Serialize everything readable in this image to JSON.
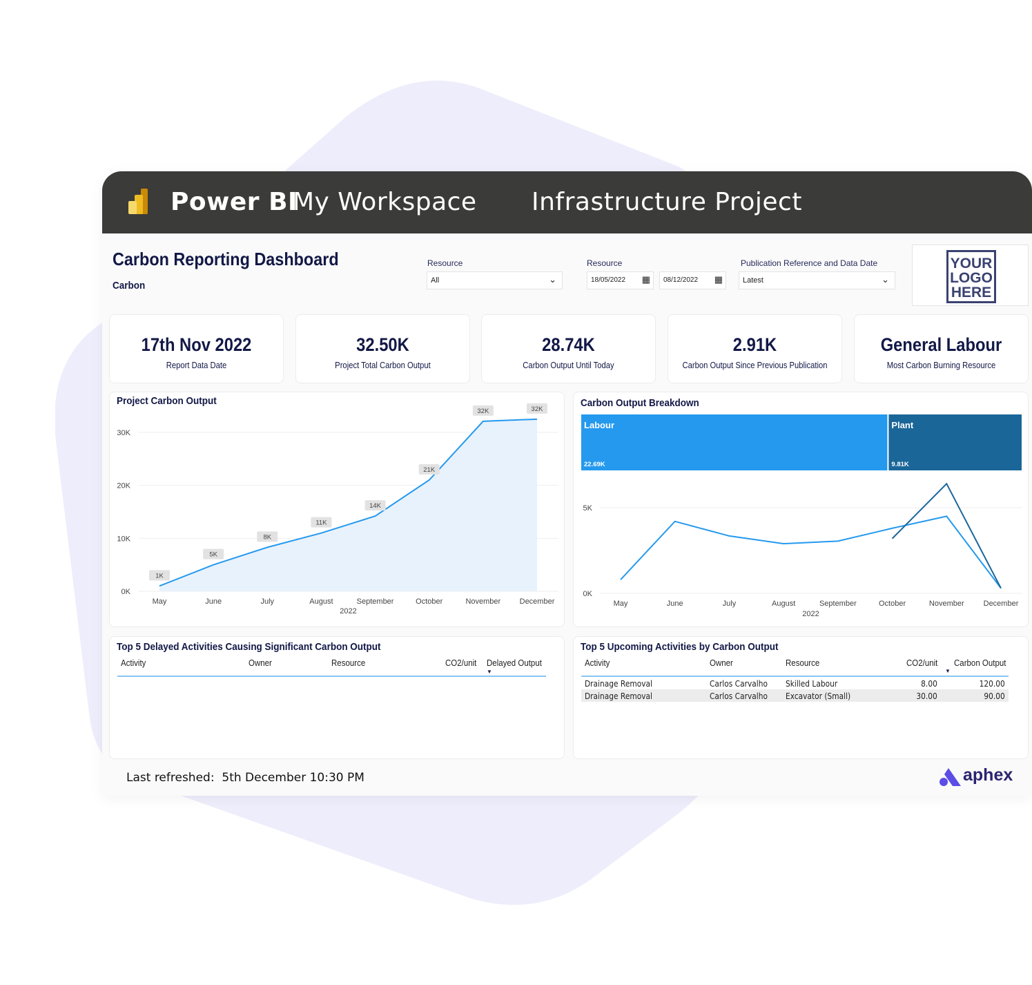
{
  "colors": {
    "accent": "#2499ee",
    "plant": "#1a6699",
    "header_bg": "#3b3b39",
    "title": "#121846",
    "background_shape": "#eeedfb"
  },
  "topbar": {
    "logo_icon": "power-bi-logo",
    "app": "Power BI",
    "workspace": "My Workspace",
    "project": "Infrastructure Project"
  },
  "header": {
    "title": "Carbon Reporting Dashboard",
    "subtitle": "Carbon",
    "logo_text": [
      "YOUR",
      "LOGO",
      "HERE"
    ]
  },
  "filters": {
    "resource": {
      "label": "Resource",
      "value": "All"
    },
    "date_range": {
      "label": "Resource",
      "start": "18/05/2022",
      "end": "08/12/2022"
    },
    "publication": {
      "label": "Publication Reference and Data Date",
      "value": "Latest"
    }
  },
  "cards": [
    {
      "value": "17th Nov 2022",
      "label": "Report Data Date"
    },
    {
      "value": "32.50K",
      "label": "Project Total Carbon Output"
    },
    {
      "value": "28.74K",
      "label": "Carbon Output Until Today"
    },
    {
      "value": "2.91K",
      "label": "Carbon Output Since Previous Publication"
    },
    {
      "value": "General Labour",
      "label": "Most Carbon Burning Resource"
    }
  ],
  "chart_data": [
    {
      "type": "area",
      "title": "Project Carbon Output",
      "categories": [
        "May",
        "June",
        "July",
        "August",
        "September",
        "October",
        "November",
        "December"
      ],
      "xlabel": "2022",
      "values": [
        1000,
        5000,
        8300,
        11000,
        14200,
        21000,
        32100,
        32500
      ],
      "data_labels": [
        "1K",
        "5K",
        "8K",
        "11K",
        "14K",
        "21K",
        "32K",
        "32K"
      ],
      "ylim": [
        0,
        30000
      ],
      "yticks": [
        "0K",
        "10K",
        "20K",
        "30K"
      ],
      "grid": true
    },
    {
      "type": "treemap",
      "title": "Carbon Output Breakdown",
      "series": [
        {
          "name": "Labour",
          "value": 22690,
          "label": "22.69K"
        },
        {
          "name": "Plant",
          "value": 9810,
          "label": "9.81K"
        }
      ]
    },
    {
      "type": "line",
      "categories": [
        "May",
        "June",
        "July",
        "August",
        "September",
        "October",
        "November",
        "December"
      ],
      "xlabel": "2022",
      "yticks": [
        "0K",
        "5K"
      ],
      "ylim": [
        0,
        6500
      ],
      "grid": true,
      "series": [
        {
          "name": "Labour",
          "values": [
            800,
            4200,
            3350,
            2900,
            3050,
            3800,
            4500,
            300
          ]
        },
        {
          "name": "Plant",
          "values": [
            null,
            null,
            null,
            null,
            null,
            3200,
            6400,
            300
          ]
        }
      ]
    }
  ],
  "delayed": {
    "title": "Top 5 Delayed Activities Causing Significant Carbon Output",
    "columns": [
      "Activity",
      "Owner",
      "Resource",
      "CO2/unit",
      "Delayed Output"
    ],
    "rows": []
  },
  "upcoming": {
    "title": "Top 5 Upcoming Activities by Carbon Output",
    "columns": [
      "Activity",
      "Owner",
      "Resource",
      "CO2/unit",
      "Carbon Output"
    ],
    "rows": [
      [
        "Drainage Removal",
        "Carlos Carvalho",
        "Skilled Labour",
        "8.00",
        "120.00"
      ],
      [
        "Drainage Removal",
        "Carlos Carvalho",
        "Excavator (Small)",
        "30.00",
        "90.00"
      ]
    ]
  },
  "footer": {
    "refreshed_label": "Last refreshed:",
    "refreshed_value": "5th December 10:30 PM",
    "brand": "aphex"
  }
}
